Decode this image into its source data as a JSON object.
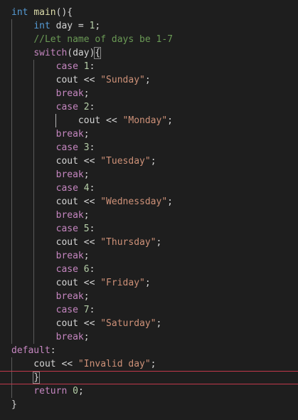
{
  "colors": {
    "background": "#1e1e1e",
    "keyword": "#569cd6",
    "function": "#dcdcaa",
    "plain": "#d4d4d4",
    "number": "#b5cea8",
    "string": "#ce9178",
    "comment": "#6a9955",
    "control": "#c586c0",
    "variable": "#9cdcfe",
    "active_line_border": "#c0394b"
  },
  "code_lines": [
    [
      {
        "t": "int",
        "c": "keyword"
      },
      {
        "t": " ",
        "c": "plain"
      },
      {
        "t": "main",
        "c": "function"
      },
      {
        "t": "(){",
        "c": "plain"
      }
    ],
    [
      {
        "t": "    ",
        "c": "plain"
      },
      {
        "t": "int",
        "c": "keyword"
      },
      {
        "t": " day = ",
        "c": "plain"
      },
      {
        "t": "1",
        "c": "number"
      },
      {
        "t": ";",
        "c": "plain"
      }
    ],
    [
      {
        "t": "    ",
        "c": "plain"
      },
      {
        "t": "//Let name of days be 1-7",
        "c": "comment"
      }
    ],
    [
      {
        "t": "    ",
        "c": "plain"
      },
      {
        "t": "switch",
        "c": "control"
      },
      {
        "t": "(",
        "c": "plain"
      },
      {
        "t": "day",
        "c": "plain"
      },
      {
        "t": ")",
        "c": "plain"
      },
      {
        "t": "{",
        "c": "plain",
        "match": true
      }
    ],
    [
      {
        "t": "        ",
        "c": "plain"
      },
      {
        "t": "case",
        "c": "control"
      },
      {
        "t": " ",
        "c": "plain"
      },
      {
        "t": "1",
        "c": "number"
      },
      {
        "t": ":",
        "c": "plain"
      }
    ],
    [
      {
        "t": "        cout << ",
        "c": "plain"
      },
      {
        "t": "\"Sunday\"",
        "c": "string"
      },
      {
        "t": ";",
        "c": "plain"
      }
    ],
    [
      {
        "t": "        ",
        "c": "plain"
      },
      {
        "t": "break",
        "c": "control"
      },
      {
        "t": ";",
        "c": "plain"
      }
    ],
    [
      {
        "t": "        ",
        "c": "plain"
      },
      {
        "t": "case",
        "c": "control"
      },
      {
        "t": " ",
        "c": "plain"
      },
      {
        "t": "2",
        "c": "number"
      },
      {
        "t": ":",
        "c": "plain"
      }
    ],
    [
      {
        "t": "            cout << ",
        "c": "plain"
      },
      {
        "t": "\"Monday\"",
        "c": "string"
      },
      {
        "t": ";",
        "c": "plain"
      }
    ],
    [
      {
        "t": "        ",
        "c": "plain"
      },
      {
        "t": "break",
        "c": "control"
      },
      {
        "t": ";",
        "c": "plain"
      }
    ],
    [
      {
        "t": "        ",
        "c": "plain"
      },
      {
        "t": "case",
        "c": "control"
      },
      {
        "t": " ",
        "c": "plain"
      },
      {
        "t": "3",
        "c": "number"
      },
      {
        "t": ":",
        "c": "plain"
      }
    ],
    [
      {
        "t": "        cout << ",
        "c": "plain"
      },
      {
        "t": "\"Tuesday\"",
        "c": "string"
      },
      {
        "t": ";",
        "c": "plain"
      }
    ],
    [
      {
        "t": "        ",
        "c": "plain"
      },
      {
        "t": "break",
        "c": "control"
      },
      {
        "t": ";",
        "c": "plain"
      }
    ],
    [
      {
        "t": "        ",
        "c": "plain"
      },
      {
        "t": "case",
        "c": "control"
      },
      {
        "t": " ",
        "c": "plain"
      },
      {
        "t": "4",
        "c": "number"
      },
      {
        "t": ":",
        "c": "plain"
      }
    ],
    [
      {
        "t": "        cout << ",
        "c": "plain"
      },
      {
        "t": "\"Wednessday\"",
        "c": "string"
      },
      {
        "t": ";",
        "c": "plain"
      }
    ],
    [
      {
        "t": "        ",
        "c": "plain"
      },
      {
        "t": "break",
        "c": "control"
      },
      {
        "t": ";",
        "c": "plain"
      }
    ],
    [
      {
        "t": "        ",
        "c": "plain"
      },
      {
        "t": "case",
        "c": "control"
      },
      {
        "t": " ",
        "c": "plain"
      },
      {
        "t": "5",
        "c": "number"
      },
      {
        "t": ":",
        "c": "plain"
      }
    ],
    [
      {
        "t": "        cout << ",
        "c": "plain"
      },
      {
        "t": "\"Thursday\"",
        "c": "string"
      },
      {
        "t": ";",
        "c": "plain"
      }
    ],
    [
      {
        "t": "        ",
        "c": "plain"
      },
      {
        "t": "break",
        "c": "control"
      },
      {
        "t": ";",
        "c": "plain"
      }
    ],
    [
      {
        "t": "        ",
        "c": "plain"
      },
      {
        "t": "case",
        "c": "control"
      },
      {
        "t": " ",
        "c": "plain"
      },
      {
        "t": "6",
        "c": "number"
      },
      {
        "t": ":",
        "c": "plain"
      }
    ],
    [
      {
        "t": "        cout << ",
        "c": "plain"
      },
      {
        "t": "\"Friday\"",
        "c": "string"
      },
      {
        "t": ";",
        "c": "plain"
      }
    ],
    [
      {
        "t": "        ",
        "c": "plain"
      },
      {
        "t": "break",
        "c": "control"
      },
      {
        "t": ";",
        "c": "plain"
      }
    ],
    [
      {
        "t": "        ",
        "c": "plain"
      },
      {
        "t": "case",
        "c": "control"
      },
      {
        "t": " ",
        "c": "plain"
      },
      {
        "t": "7",
        "c": "number"
      },
      {
        "t": ":",
        "c": "plain"
      }
    ],
    [
      {
        "t": "        cout << ",
        "c": "plain"
      },
      {
        "t": "\"Saturday\"",
        "c": "string"
      },
      {
        "t": ";",
        "c": "plain"
      }
    ],
    [
      {
        "t": "        ",
        "c": "plain"
      },
      {
        "t": "break",
        "c": "control"
      },
      {
        "t": ";",
        "c": "plain"
      }
    ],
    [
      {
        "t": "default",
        "c": "control"
      },
      {
        "t": ":",
        "c": "plain"
      }
    ],
    [
      {
        "t": "    cout << ",
        "c": "plain"
      },
      {
        "t": "\"Invalid day\"",
        "c": "string"
      },
      {
        "t": ";",
        "c": "plain"
      }
    ],
    [
      {
        "t": "    ",
        "c": "plain"
      },
      {
        "t": "}",
        "c": "plain",
        "match": true,
        "caret": true
      }
    ],
    [
      {
        "t": "    ",
        "c": "plain"
      },
      {
        "t": "return",
        "c": "control"
      },
      {
        "t": " ",
        "c": "plain"
      },
      {
        "t": "0",
        "c": "number"
      },
      {
        "t": ";",
        "c": "plain"
      }
    ],
    [
      {
        "t": "}",
        "c": "plain"
      }
    ]
  ],
  "active_line": 27
}
